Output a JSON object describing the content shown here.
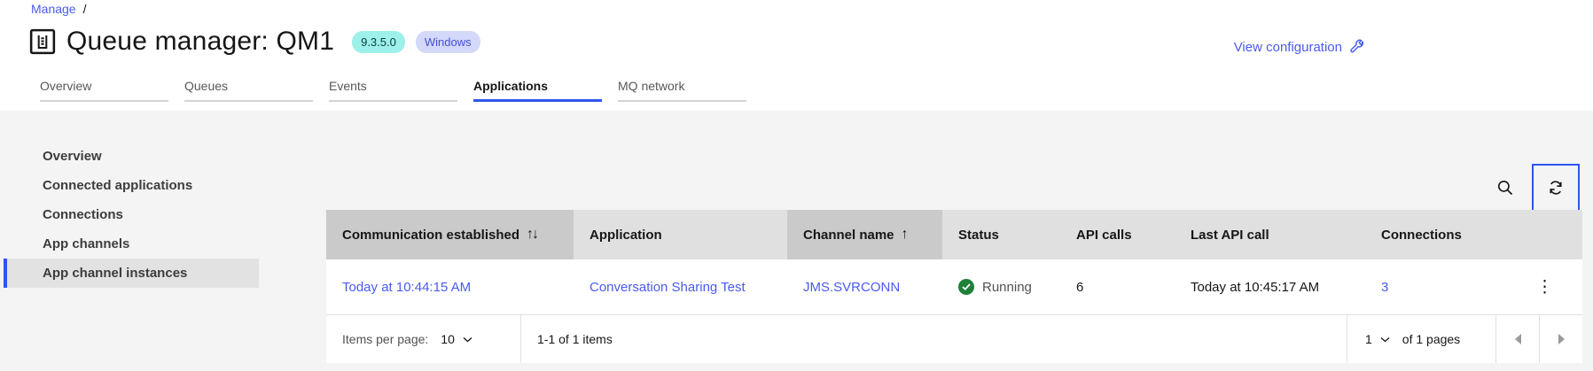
{
  "breadcrumb": {
    "items": [
      {
        "label": "Manage"
      }
    ],
    "separator": "/"
  },
  "header": {
    "title": "Queue manager: QM1",
    "version_badge": "9.3.5.0",
    "platform_badge": "Windows",
    "view_configuration_label": "View configuration"
  },
  "tabs": [
    {
      "label": "Overview",
      "active": false
    },
    {
      "label": "Queues",
      "active": false
    },
    {
      "label": "Events",
      "active": false
    },
    {
      "label": "Applications",
      "active": true
    },
    {
      "label": "MQ network",
      "active": false
    }
  ],
  "sidebar": {
    "items": [
      {
        "label": "Overview",
        "active": false
      },
      {
        "label": "Connected applications",
        "active": false
      },
      {
        "label": "Connections",
        "active": false
      },
      {
        "label": "App channels",
        "active": false
      },
      {
        "label": "App channel instances",
        "active": true
      }
    ]
  },
  "table": {
    "columns": [
      {
        "label": "Communication established",
        "sort": "both"
      },
      {
        "label": "Application",
        "sort": null
      },
      {
        "label": "Channel name",
        "sort": "asc"
      },
      {
        "label": "Status",
        "sort": null
      },
      {
        "label": "API calls",
        "sort": null
      },
      {
        "label": "Last API call",
        "sort": null
      },
      {
        "label": "Connections",
        "sort": null
      }
    ],
    "rows": [
      {
        "communication_established": "Today at 10:44:15 AM",
        "application": "Conversation Sharing Test",
        "channel_name": "JMS.SVRCONN",
        "status": "Running",
        "api_calls": "6",
        "last_api_call": "Today at 10:45:17 AM",
        "connections": "3"
      }
    ]
  },
  "pagination": {
    "items_per_page_label": "Items per page:",
    "items_per_page_value": "10",
    "range_text": "1-1 of 1 items",
    "page_value": "1",
    "pages_text": "of 1 pages"
  },
  "icons": {
    "title": "queue-manager-icon",
    "view_configuration": "wrench-icon",
    "toolbar": [
      "search-icon",
      "refresh-icon"
    ],
    "row_status": "checkmark-circle-icon",
    "row_overflow": "kebab-menu-icon"
  },
  "colors": {
    "accent_blue": "#2e55ee",
    "link_blue": "#4a5bef",
    "status_green": "#1f8038",
    "version_badge_bg": "#9ef0ea",
    "version_badge_text": "#07423f",
    "platform_badge_bg": "#d4d8f9",
    "platform_badge_text": "#4450d2",
    "content_bg": "#f4f4f4",
    "header_cell_bg": "#e0e0e0",
    "sorted_cell_bg": "#cacaca"
  }
}
